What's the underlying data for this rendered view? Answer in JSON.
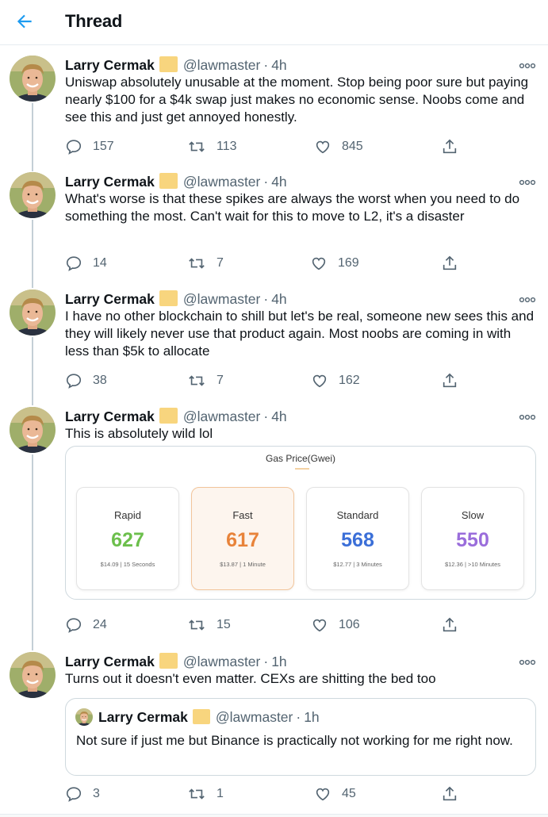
{
  "header": {
    "title": "Thread"
  },
  "tweets": [
    {
      "name": "Larry Cermak",
      "handle": "@lawmaster",
      "dot": "·",
      "time": "4h",
      "text": "Uniswap absolutely unusable at the moment. Stop being poor sure but paying nearly $100 for a $4k swap just makes no economic sense. Noobs come and see this and just get annoyed honestly.",
      "replies": "157",
      "retweets": "113",
      "likes": "845"
    },
    {
      "name": "Larry Cermak",
      "handle": "@lawmaster",
      "dot": "·",
      "time": "4h",
      "text": "What's worse is that these spikes are always the worst when you need to do something the most. Can't wait for this to move to L2, it's a disaster",
      "replies": "14",
      "retweets": "7",
      "likes": "169"
    },
    {
      "name": "Larry Cermak",
      "handle": "@lawmaster",
      "dot": "·",
      "time": "4h",
      "text": "I have no other blockchain to shill but let's be real, someone new sees this and they will likely never use that product again. Most noobs are coming in with less than $5k to allocate",
      "replies": "38",
      "retweets": "7",
      "likes": "162"
    },
    {
      "name": "Larry Cermak",
      "handle": "@lawmaster",
      "dot": "·",
      "time": "4h",
      "text": "This is absolutely wild lol",
      "replies": "24",
      "retweets": "15",
      "likes": "106",
      "card": {
        "title": "Gas Price(Gwei)",
        "boxes": [
          {
            "label": "Rapid",
            "value": "627",
            "sub": "$14.09 | 15 Seconds",
            "color": "#6cbf4c"
          },
          {
            "label": "Fast",
            "value": "617",
            "sub": "$13.87 | 1 Minute",
            "color": "#e8833a"
          },
          {
            "label": "Standard",
            "value": "568",
            "sub": "$12.77 | 3 Minutes",
            "color": "#3b6fd8"
          },
          {
            "label": "Slow",
            "value": "550",
            "sub": "$12.36 | >10 Minutes",
            "color": "#9a6ddb"
          }
        ]
      }
    },
    {
      "name": "Larry Cermak",
      "handle": "@lawmaster",
      "dot": "·",
      "time": "1h",
      "text": "Turns out it doesn't even matter. CEXs are shitting the bed too",
      "replies": "3",
      "retweets": "1",
      "likes": "45",
      "quote": {
        "name": "Larry Cermak",
        "handle": "@lawmaster",
        "dot": "·",
        "time": "1h",
        "text": "Not sure if just me but Binance is practically not working for me right now."
      }
    }
  ],
  "colors": {
    "accent": "#1d9bf0",
    "muted": "#536471",
    "badge": "#f8d57e"
  },
  "icons": [
    "back-arrow-icon",
    "more-icon",
    "reply-icon",
    "retweet-icon",
    "like-icon",
    "share-icon",
    "verified-badge"
  ]
}
